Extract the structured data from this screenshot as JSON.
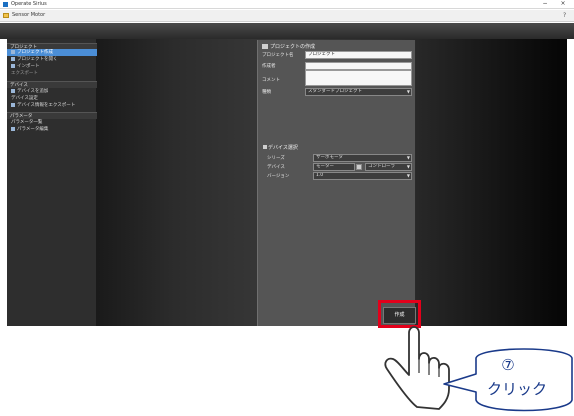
{
  "window": {
    "title": "Operate Sirius",
    "min_label": "−",
    "close_label": "×"
  },
  "menubar": {
    "label": "Sensor Motor",
    "help_label": "?"
  },
  "sidebar": {
    "sections": [
      {
        "label": "プロジェクト"
      },
      {
        "label": "デバイス"
      },
      {
        "label": "パラメータ"
      }
    ],
    "items": [
      {
        "label": "プロジェクト作成"
      },
      {
        "label": "プロジェクトを開く"
      },
      {
        "label": "インポート"
      },
      {
        "label": "エクスポート"
      },
      {
        "label": "デバイスを追加"
      },
      {
        "label": "デバイス設定"
      },
      {
        "label": "デバイス情報をエクスポート"
      },
      {
        "label": "パラメータ一覧"
      },
      {
        "label": "パラメータ編集"
      }
    ]
  },
  "panel": {
    "heading": "プロジェクトの作成",
    "fields": {
      "name_label": "プロジェクト名",
      "name_value": "プロジェクト",
      "author_label": "作成者",
      "author_value": "",
      "comment_label": "コメント",
      "comment_value": "",
      "type_label": "種類",
      "type_value": "スタンダードプロジェクト"
    },
    "device": {
      "heading": "デバイス選択",
      "row1_label": "シリーズ",
      "row1_value": "サーボモータ",
      "row2_label": "デバイス",
      "row2_value": "モーター",
      "row2_extra": "コントローラ",
      "row3_label": "バージョン",
      "row3_value": "1.0"
    },
    "create_button": "作成"
  },
  "callout": {
    "step_number": "⑦",
    "text": "クリック",
    "color": "#1a3a8a"
  },
  "colors": {
    "highlight": "#e3001b",
    "active_item": "#4b8ed6"
  }
}
